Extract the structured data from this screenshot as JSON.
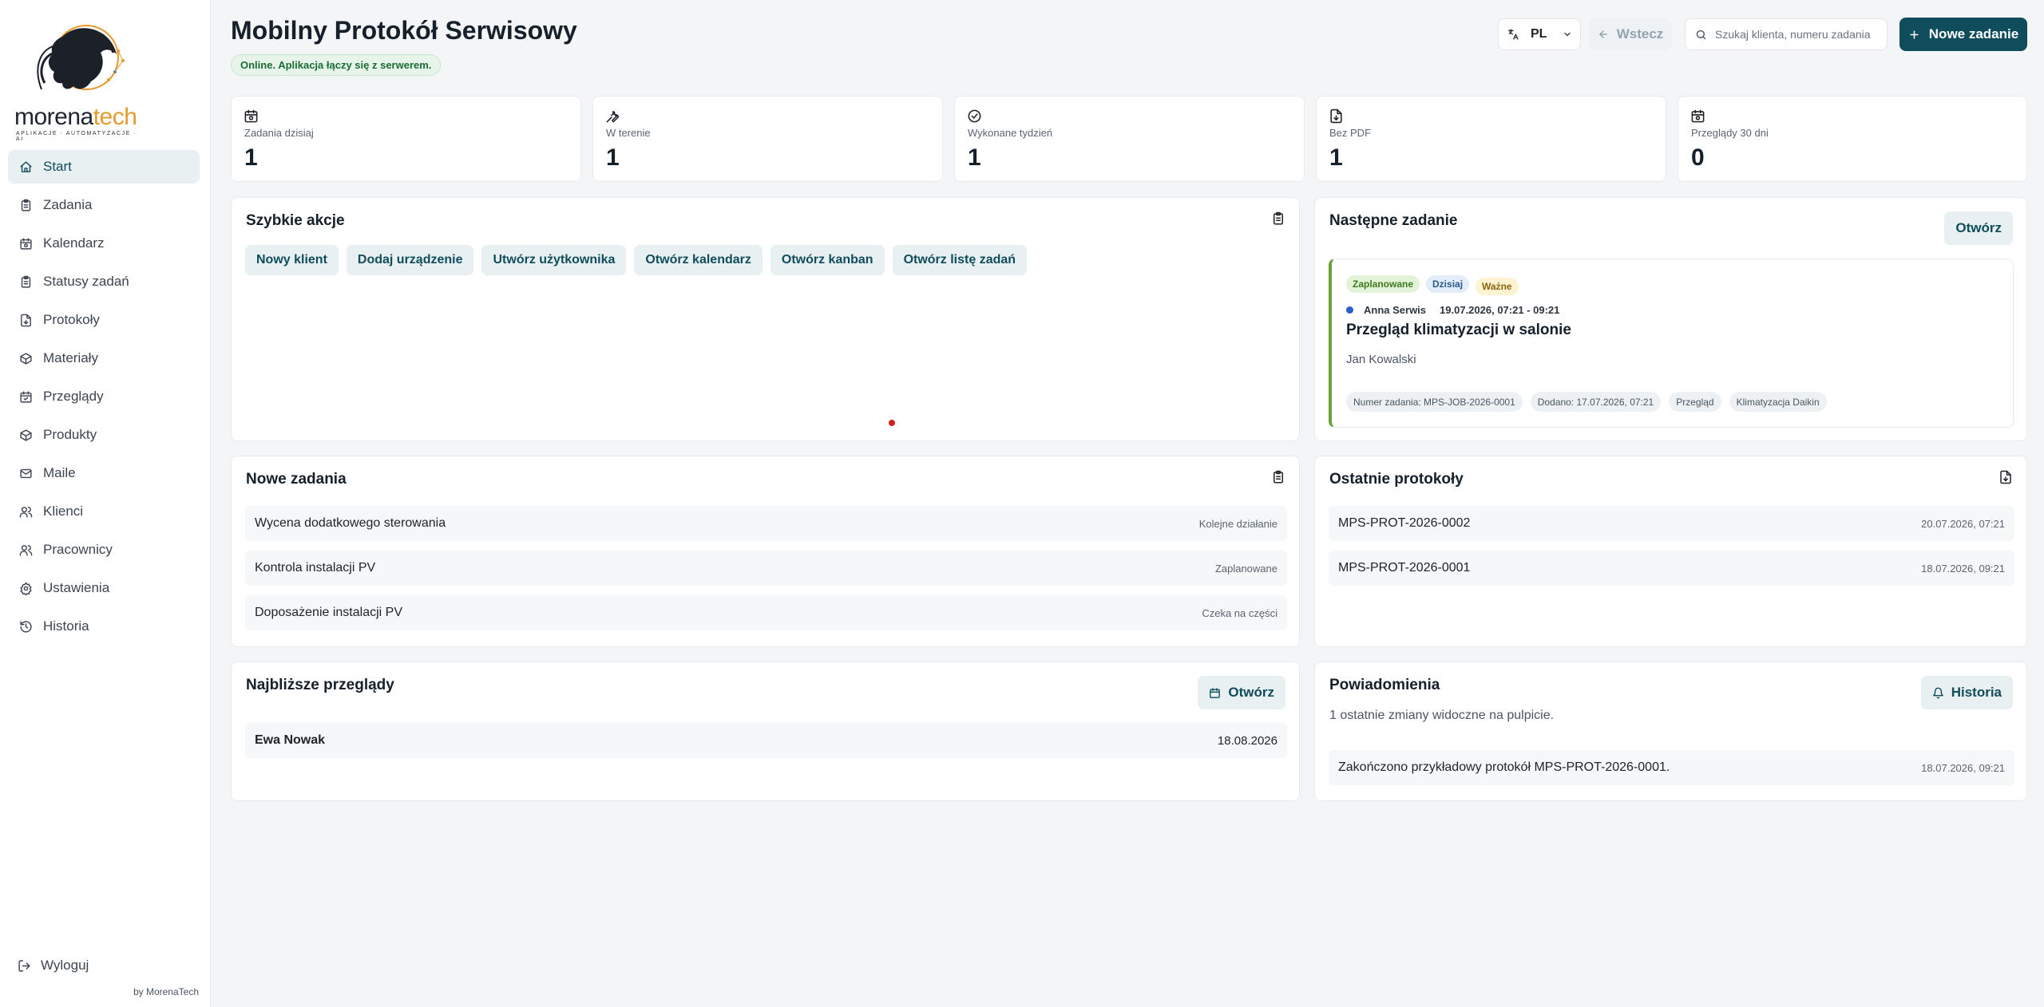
{
  "brand": {
    "name_main": "morena",
    "name_accent": "tech",
    "tagline": "APLIKACJE · AUTOMATYZACJE · AI",
    "accent_color": "#e79a2c",
    "byline": "by MorenaTech"
  },
  "sidebar": {
    "items": [
      {
        "label": "Start",
        "icon": "home-icon",
        "active": true
      },
      {
        "label": "Zadania",
        "icon": "clipboard-icon"
      },
      {
        "label": "Kalendarz",
        "icon": "calendar-icon"
      },
      {
        "label": "Statusy zadań",
        "icon": "clipboard-icon"
      },
      {
        "label": "Protokoły",
        "icon": "document-icon"
      },
      {
        "label": "Materiały",
        "icon": "box-icon"
      },
      {
        "label": "Przeglądy",
        "icon": "calendar-check-icon"
      },
      {
        "label": "Produkty",
        "icon": "box-icon"
      },
      {
        "label": "Maile",
        "icon": "mail-icon"
      },
      {
        "label": "Klienci",
        "icon": "users-icon"
      },
      {
        "label": "Pracownicy",
        "icon": "users-icon"
      },
      {
        "label": "Ustawienia",
        "icon": "gear-icon"
      },
      {
        "label": "Historia",
        "icon": "history-icon"
      }
    ],
    "logout_label": "Wyloguj"
  },
  "header": {
    "title": "Mobilny Protokół Serwisowy",
    "status": "Online. Aplikacja łączy się z serwerem.",
    "language": "PL",
    "back_label": "Wstecz",
    "search_placeholder": "Szukaj klienta, numeru zadania",
    "new_task_label": "Nowe zadanie",
    "primary_color": "#0f4c5c"
  },
  "stats": [
    {
      "label": "Zadania dzisiaj",
      "value": "1",
      "icon": "calendar-icon"
    },
    {
      "label": "W terenie",
      "value": "1",
      "icon": "wrench-icon"
    },
    {
      "label": "Wykonane tydzień",
      "value": "1",
      "icon": "check-circle-icon"
    },
    {
      "label": "Bez PDF",
      "value": "1",
      "icon": "document-icon"
    },
    {
      "label": "Przeglądy 30 dni",
      "value": "0",
      "icon": "calendar-icon"
    }
  ],
  "quick_actions": {
    "title": "Szybkie akcje",
    "actions": [
      "Nowy klient",
      "Dodaj urządzenie",
      "Utwórz użytkownika",
      "Otwórz kalendarz",
      "Otwórz kanban",
      "Otwórz listę zadań"
    ]
  },
  "next_task": {
    "title": "Następne zadanie",
    "open_label": "Otwórz",
    "tags": [
      "Zaplanowane",
      "Dzisiaj",
      "Ważne"
    ],
    "technician": "Anna Serwis",
    "time": "19.07.2026, 07:21 - 09:21",
    "task_title": "Przegląd klimatyzacji w salonie",
    "client": "Jan Kowalski",
    "badges": [
      "Numer zadania: MPS-JOB-2026-0001",
      "Dodano: 17.07.2026, 07:21",
      "Przegląd",
      "Klimatyzacja Daikin"
    ]
  },
  "new_tasks": {
    "title": "Nowe zadania",
    "items": [
      {
        "name": "Wycena dodatkowego sterowania",
        "status": "Kolejne działanie"
      },
      {
        "name": "Kontrola instalacji PV",
        "status": "Zaplanowane"
      },
      {
        "name": "Doposażenie instalacji PV",
        "status": "Czeka na części"
      }
    ]
  },
  "protocols": {
    "title": "Ostatnie protokoły",
    "items": [
      {
        "number": "MPS-PROT-2026-0002",
        "date": "20.07.2026, 07:21"
      },
      {
        "number": "MPS-PROT-2026-0001",
        "date": "18.07.2026, 09:21"
      }
    ]
  },
  "inspections": {
    "title": "Najbliższe przeglądy",
    "open_label": "Otwórz",
    "items": [
      {
        "client": "Ewa Nowak",
        "date": "18.08.2026"
      }
    ]
  },
  "notifications": {
    "title": "Powiadomienia",
    "history_label": "Historia",
    "summary": "1 ostatnie zmiany widoczne na pulpicie.",
    "items": [
      {
        "text": "Zakończono przykładowy protokół MPS-PROT-2026-0001.",
        "date": "18.07.2026, 09:21"
      }
    ]
  }
}
